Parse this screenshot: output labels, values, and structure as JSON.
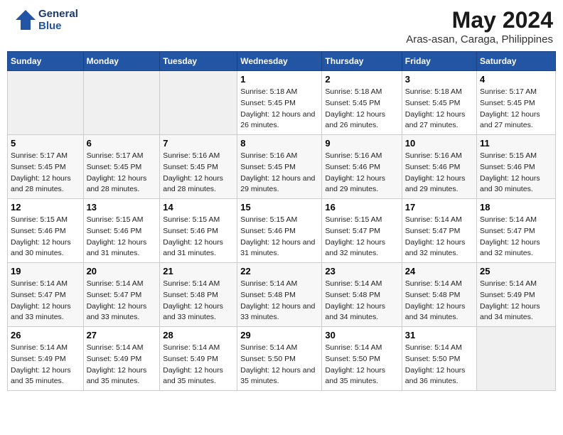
{
  "logo": {
    "text_general": "General",
    "text_blue": "Blue"
  },
  "title": "May 2024",
  "subtitle": "Aras-asan, Caraga, Philippines",
  "days_of_week": [
    "Sunday",
    "Monday",
    "Tuesday",
    "Wednesday",
    "Thursday",
    "Friday",
    "Saturday"
  ],
  "weeks": [
    [
      {
        "day": "",
        "sunrise": "",
        "sunset": "",
        "daylight": "",
        "empty": true
      },
      {
        "day": "",
        "sunrise": "",
        "sunset": "",
        "daylight": "",
        "empty": true
      },
      {
        "day": "",
        "sunrise": "",
        "sunset": "",
        "daylight": "",
        "empty": true
      },
      {
        "day": "1",
        "sunrise": "Sunrise: 5:18 AM",
        "sunset": "Sunset: 5:45 PM",
        "daylight": "Daylight: 12 hours and 26 minutes."
      },
      {
        "day": "2",
        "sunrise": "Sunrise: 5:18 AM",
        "sunset": "Sunset: 5:45 PM",
        "daylight": "Daylight: 12 hours and 26 minutes."
      },
      {
        "day": "3",
        "sunrise": "Sunrise: 5:18 AM",
        "sunset": "Sunset: 5:45 PM",
        "daylight": "Daylight: 12 hours and 27 minutes."
      },
      {
        "day": "4",
        "sunrise": "Sunrise: 5:17 AM",
        "sunset": "Sunset: 5:45 PM",
        "daylight": "Daylight: 12 hours and 27 minutes."
      }
    ],
    [
      {
        "day": "5",
        "sunrise": "Sunrise: 5:17 AM",
        "sunset": "Sunset: 5:45 PM",
        "daylight": "Daylight: 12 hours and 28 minutes."
      },
      {
        "day": "6",
        "sunrise": "Sunrise: 5:17 AM",
        "sunset": "Sunset: 5:45 PM",
        "daylight": "Daylight: 12 hours and 28 minutes."
      },
      {
        "day": "7",
        "sunrise": "Sunrise: 5:16 AM",
        "sunset": "Sunset: 5:45 PM",
        "daylight": "Daylight: 12 hours and 28 minutes."
      },
      {
        "day": "8",
        "sunrise": "Sunrise: 5:16 AM",
        "sunset": "Sunset: 5:45 PM",
        "daylight": "Daylight: 12 hours and 29 minutes."
      },
      {
        "day": "9",
        "sunrise": "Sunrise: 5:16 AM",
        "sunset": "Sunset: 5:46 PM",
        "daylight": "Daylight: 12 hours and 29 minutes."
      },
      {
        "day": "10",
        "sunrise": "Sunrise: 5:16 AM",
        "sunset": "Sunset: 5:46 PM",
        "daylight": "Daylight: 12 hours and 29 minutes."
      },
      {
        "day": "11",
        "sunrise": "Sunrise: 5:15 AM",
        "sunset": "Sunset: 5:46 PM",
        "daylight": "Daylight: 12 hours and 30 minutes."
      }
    ],
    [
      {
        "day": "12",
        "sunrise": "Sunrise: 5:15 AM",
        "sunset": "Sunset: 5:46 PM",
        "daylight": "Daylight: 12 hours and 30 minutes."
      },
      {
        "day": "13",
        "sunrise": "Sunrise: 5:15 AM",
        "sunset": "Sunset: 5:46 PM",
        "daylight": "Daylight: 12 hours and 31 minutes."
      },
      {
        "day": "14",
        "sunrise": "Sunrise: 5:15 AM",
        "sunset": "Sunset: 5:46 PM",
        "daylight": "Daylight: 12 hours and 31 minutes."
      },
      {
        "day": "15",
        "sunrise": "Sunrise: 5:15 AM",
        "sunset": "Sunset: 5:46 PM",
        "daylight": "Daylight: 12 hours and 31 minutes."
      },
      {
        "day": "16",
        "sunrise": "Sunrise: 5:15 AM",
        "sunset": "Sunset: 5:47 PM",
        "daylight": "Daylight: 12 hours and 32 minutes."
      },
      {
        "day": "17",
        "sunrise": "Sunrise: 5:14 AM",
        "sunset": "Sunset: 5:47 PM",
        "daylight": "Daylight: 12 hours and 32 minutes."
      },
      {
        "day": "18",
        "sunrise": "Sunrise: 5:14 AM",
        "sunset": "Sunset: 5:47 PM",
        "daylight": "Daylight: 12 hours and 32 minutes."
      }
    ],
    [
      {
        "day": "19",
        "sunrise": "Sunrise: 5:14 AM",
        "sunset": "Sunset: 5:47 PM",
        "daylight": "Daylight: 12 hours and 33 minutes."
      },
      {
        "day": "20",
        "sunrise": "Sunrise: 5:14 AM",
        "sunset": "Sunset: 5:47 PM",
        "daylight": "Daylight: 12 hours and 33 minutes."
      },
      {
        "day": "21",
        "sunrise": "Sunrise: 5:14 AM",
        "sunset": "Sunset: 5:48 PM",
        "daylight": "Daylight: 12 hours and 33 minutes."
      },
      {
        "day": "22",
        "sunrise": "Sunrise: 5:14 AM",
        "sunset": "Sunset: 5:48 PM",
        "daylight": "Daylight: 12 hours and 33 minutes."
      },
      {
        "day": "23",
        "sunrise": "Sunrise: 5:14 AM",
        "sunset": "Sunset: 5:48 PM",
        "daylight": "Daylight: 12 hours and 34 minutes."
      },
      {
        "day": "24",
        "sunrise": "Sunrise: 5:14 AM",
        "sunset": "Sunset: 5:48 PM",
        "daylight": "Daylight: 12 hours and 34 minutes."
      },
      {
        "day": "25",
        "sunrise": "Sunrise: 5:14 AM",
        "sunset": "Sunset: 5:49 PM",
        "daylight": "Daylight: 12 hours and 34 minutes."
      }
    ],
    [
      {
        "day": "26",
        "sunrise": "Sunrise: 5:14 AM",
        "sunset": "Sunset: 5:49 PM",
        "daylight": "Daylight: 12 hours and 35 minutes."
      },
      {
        "day": "27",
        "sunrise": "Sunrise: 5:14 AM",
        "sunset": "Sunset: 5:49 PM",
        "daylight": "Daylight: 12 hours and 35 minutes."
      },
      {
        "day": "28",
        "sunrise": "Sunrise: 5:14 AM",
        "sunset": "Sunset: 5:49 PM",
        "daylight": "Daylight: 12 hours and 35 minutes."
      },
      {
        "day": "29",
        "sunrise": "Sunrise: 5:14 AM",
        "sunset": "Sunset: 5:50 PM",
        "daylight": "Daylight: 12 hours and 35 minutes."
      },
      {
        "day": "30",
        "sunrise": "Sunrise: 5:14 AM",
        "sunset": "Sunset: 5:50 PM",
        "daylight": "Daylight: 12 hours and 35 minutes."
      },
      {
        "day": "31",
        "sunrise": "Sunrise: 5:14 AM",
        "sunset": "Sunset: 5:50 PM",
        "daylight": "Daylight: 12 hours and 36 minutes."
      },
      {
        "day": "",
        "sunrise": "",
        "sunset": "",
        "daylight": "",
        "empty": true
      }
    ]
  ]
}
